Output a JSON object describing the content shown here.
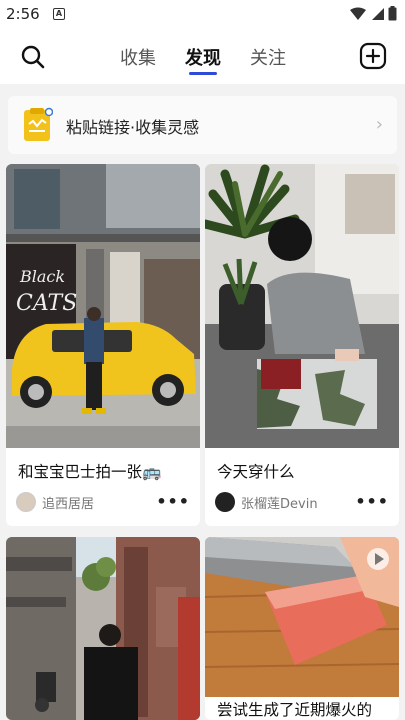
{
  "status_bar": {
    "time": "2:56",
    "notification_icon": "A"
  },
  "nav": {
    "tabs": [
      {
        "label": "收集"
      },
      {
        "label": "发现"
      },
      {
        "label": "关注"
      }
    ],
    "active_tab": "发现",
    "accent_color": "#2d4bd6"
  },
  "banner": {
    "text": "粘贴链接·收集灵感"
  },
  "feed": [
    {
      "title": "和宝宝巴士拍一张🚌",
      "author": "追西居居"
    },
    {
      "title": "今天穿什么",
      "author": "张榴莲Devin"
    },
    {
      "title": "",
      "author": ""
    },
    {
      "title": "尝试生成了近期爆火的",
      "author": ""
    }
  ]
}
